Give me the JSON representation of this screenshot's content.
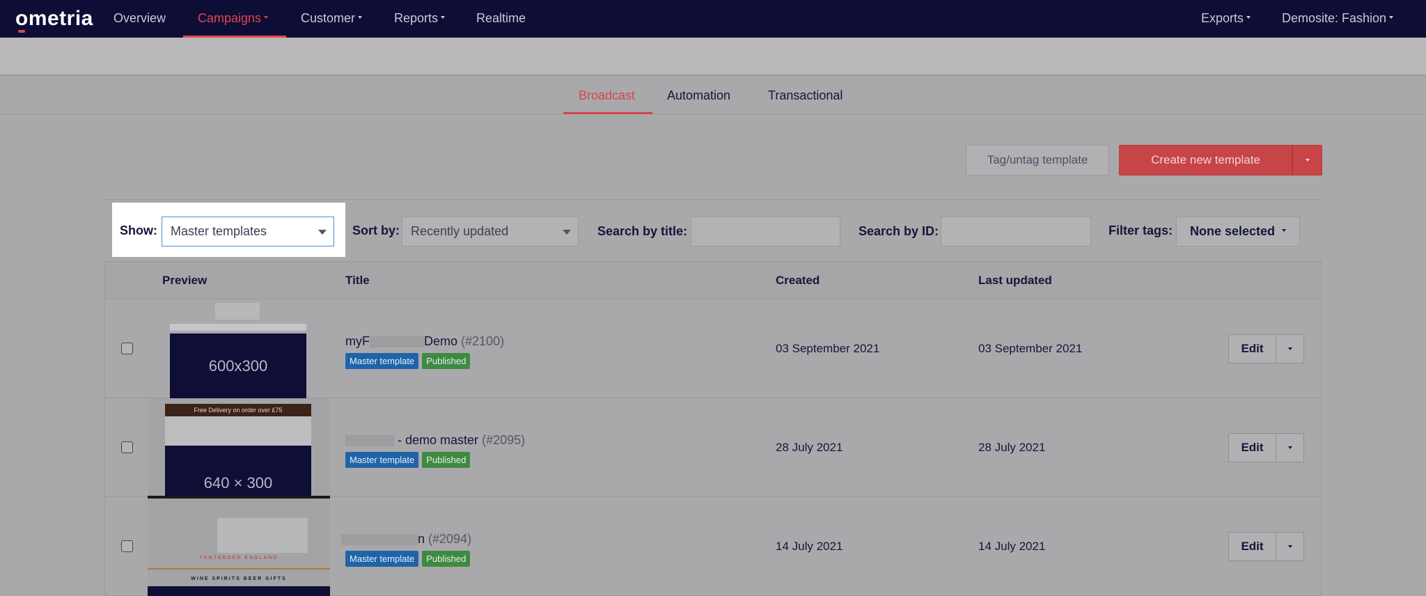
{
  "brand": {
    "name": "ometria",
    "accent": "#e0464d",
    "nav_bg": "#0d0d35"
  },
  "nav": {
    "items": [
      {
        "label": "Overview"
      },
      {
        "label": "Campaigns"
      },
      {
        "label": "Customer"
      },
      {
        "label": "Reports"
      },
      {
        "label": "Realtime"
      }
    ],
    "exports": "Exports",
    "site": "Demosite: Fashion"
  },
  "tabs": [
    {
      "label": "Broadcast"
    },
    {
      "label": "Automation"
    },
    {
      "label": "Transactional"
    }
  ],
  "actions": {
    "tag": "Tag/untag template",
    "create": "Create new template"
  },
  "filters": {
    "show_label": "Show:",
    "show_value": "Master templates",
    "sort_label": "Sort by:",
    "sort_value": "Recently updated",
    "title_label": "Search by title:",
    "id_label": "Search by ID:",
    "tags_label": "Filter tags:",
    "tags_value": "None selected"
  },
  "table": {
    "headers": {
      "preview": "Preview",
      "title": "Title",
      "created": "Created",
      "updated": "Last updated"
    },
    "rows": [
      {
        "title_pre": "myF",
        "title_post": "Demo",
        "id": "(#2100)",
        "badge1": "Master template",
        "badge2": "Published",
        "created": "03 September 2021",
        "updated": "03 September 2021",
        "edit": "Edit",
        "preview_text": "600x300"
      },
      {
        "title_pre": "",
        "title_post": "- demo master",
        "id": "(#2095)",
        "badge1": "Master template",
        "badge2": "Published",
        "created": "28 July 2021",
        "updated": "28 July 2021",
        "edit": "Edit",
        "preview_text": "640 × 300",
        "preview_banner": "Free Delivery on order over £75"
      },
      {
        "title_pre": "",
        "title_post": "n",
        "id": "(#2094)",
        "badge1": "Master template",
        "badge2": "Published",
        "created": "14 July 2021",
        "updated": "14 July 2021",
        "edit": "Edit",
        "preview_brand": "TENTERDEN ENGLAND",
        "preview_nav": "WINE  SPIRITS  BEER  GIFTS"
      }
    ]
  }
}
